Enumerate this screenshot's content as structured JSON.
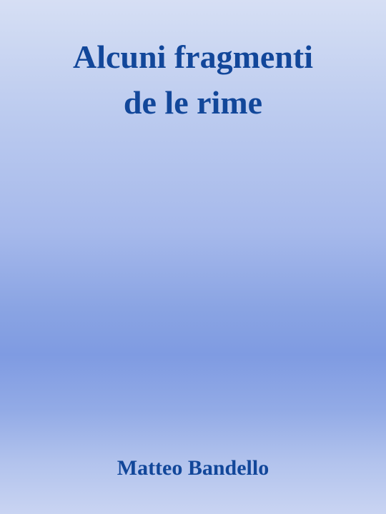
{
  "book": {
    "title_lines": [
      "Alcuni fragmenti",
      "de le rime"
    ],
    "author": "Matteo Bandello"
  },
  "colors": {
    "text": "#12479a",
    "background_top": "#d6dff4",
    "background_mid": "#7f9be2",
    "background_bottom": "#c9d4f2"
  }
}
